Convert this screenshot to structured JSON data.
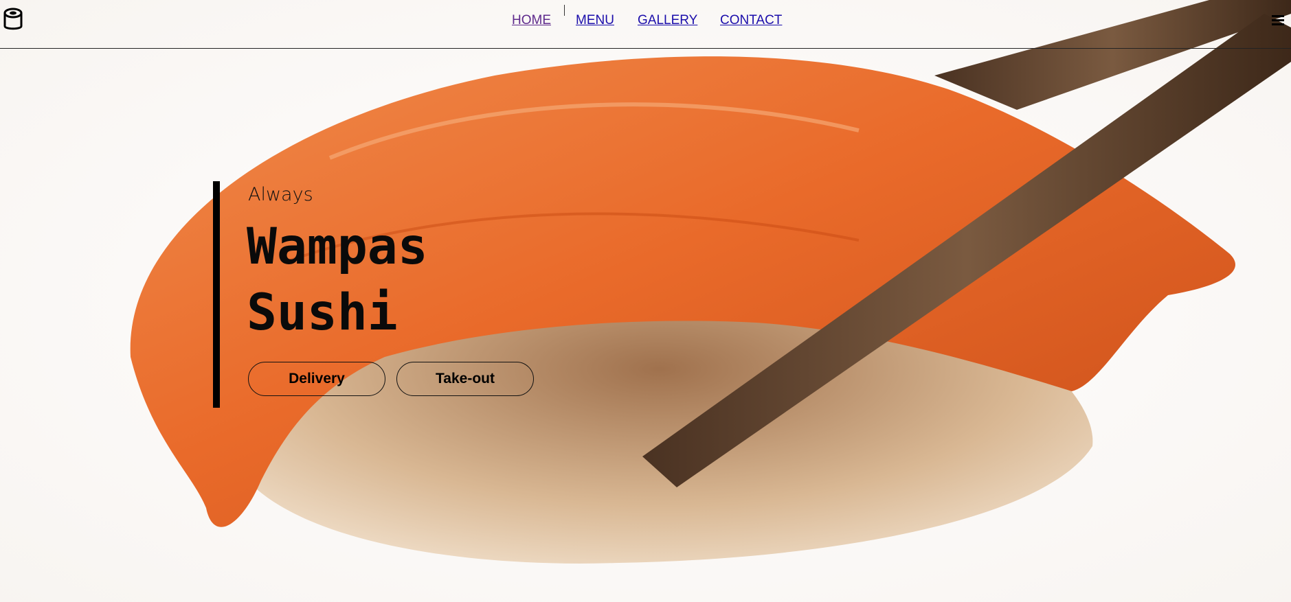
{
  "brand": {
    "logo_icon": "sushi-roll-icon"
  },
  "nav": {
    "items": [
      {
        "label": "HOME",
        "visited": true
      },
      {
        "label": "MENU"
      },
      {
        "label": "GALLERY"
      },
      {
        "label": "CONTACT"
      }
    ],
    "link_color": "#1a0dab",
    "visited_color": "#5e2a8c",
    "menu_icon": "hamburger-menu-icon"
  },
  "hero": {
    "background_image": "salmon nigiri held by chopsticks",
    "eyebrow": "Always",
    "title_line1": "Wampas",
    "title_line2": "Sushi",
    "buttons": {
      "delivery": "Delivery",
      "takeout": "Take-out"
    }
  }
}
